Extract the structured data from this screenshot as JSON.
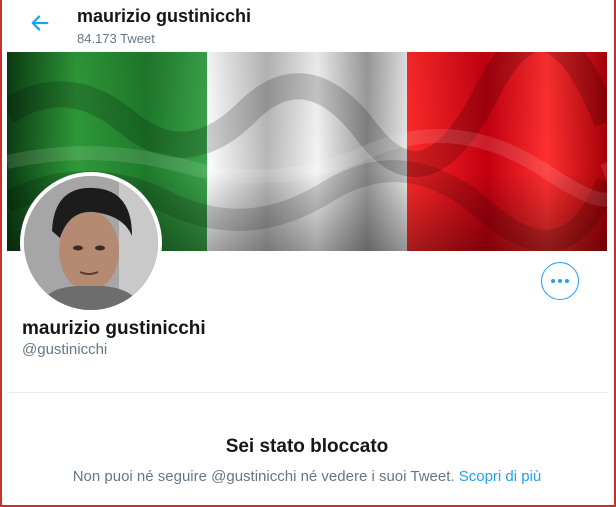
{
  "header": {
    "title": "maurizio gustinicchi",
    "tweet_count": "84.173 Tweet",
    "back_icon": "arrow-left-icon"
  },
  "profile": {
    "name": "maurizio gustinicchi",
    "handle": "@gustinicchi",
    "more_icon": "more-dots-icon"
  },
  "blocked": {
    "title": "Sei stato bloccato",
    "message": "Non puoi né seguire @gustinicchi né vedere i suoi Tweet.",
    "link": "Scopri di più"
  },
  "colors": {
    "accent": "#1da1f2",
    "flag_green": "#2e8b2e",
    "flag_white": "#e8e8e8",
    "flag_red": "#e0101a"
  }
}
